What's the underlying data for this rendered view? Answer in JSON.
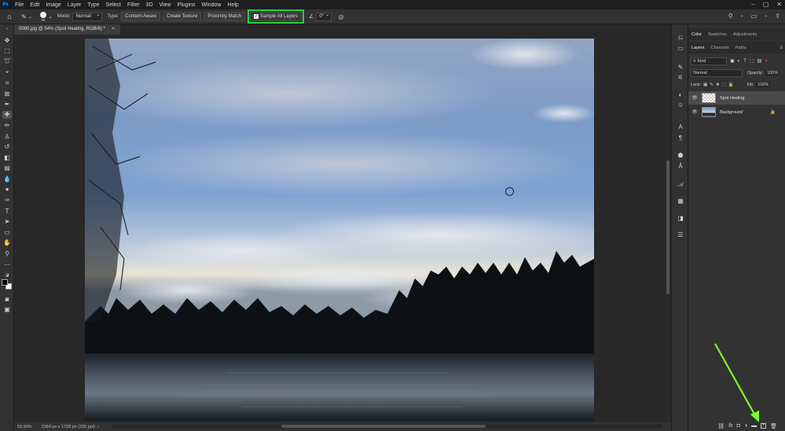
{
  "menu": {
    "app_logo": "Ps",
    "items": [
      "File",
      "Edit",
      "Image",
      "Layer",
      "Type",
      "Select",
      "Filter",
      "3D",
      "View",
      "Plugins",
      "Window",
      "Help"
    ]
  },
  "options": {
    "brush_size": "40",
    "mode_label": "Mode:",
    "mode_value": "Normal",
    "type_label": "Type:",
    "type_buttons": [
      "Content-Aware",
      "Create Texture",
      "Proximity Match"
    ],
    "sample_all_layers": "Sample All Layers",
    "angle_value": "0°"
  },
  "document": {
    "tab_title": "0090.jpg @ 54% (Spot Healing, RGB/8) *"
  },
  "status": {
    "zoom": "53.99%",
    "doc_info": "2364 px x 1728 px (230 ppi)"
  },
  "panels": {
    "top_tabs": [
      "Color",
      "Swatches",
      "Adjustments"
    ],
    "layer_tabs": [
      "Layers",
      "Channels",
      "Paths"
    ],
    "kind_label": "Kind",
    "blend_mode": "Normal",
    "opacity_label": "Opacity:",
    "opacity_value": "100%",
    "lock_label": "Lock:",
    "fill_label": "Fill:",
    "fill_value": "100%",
    "layers": [
      {
        "name": "Spot Healing"
      },
      {
        "name": "Background"
      }
    ]
  },
  "colors": {
    "highlight": "#22d33c",
    "arrow": "#7cff2a",
    "ps_blue": "#31a8ff"
  }
}
